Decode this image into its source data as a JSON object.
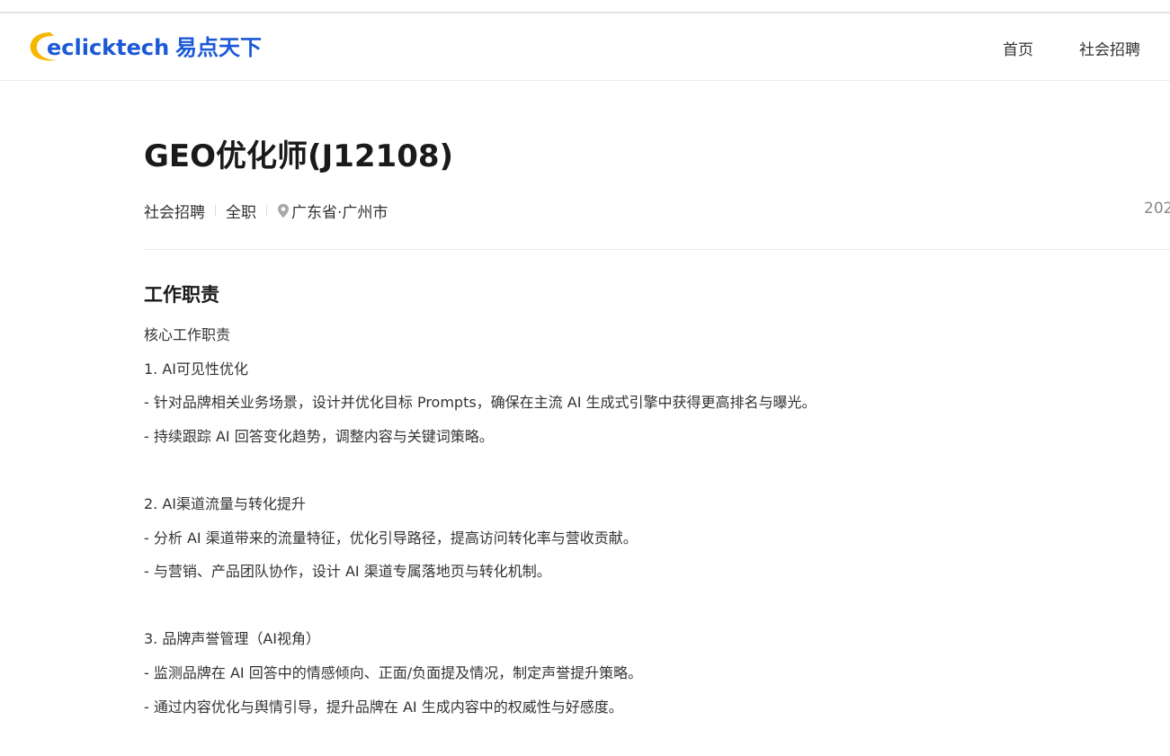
{
  "header": {
    "logo": {
      "brand_en": "eclicktech",
      "brand_cn": "易点天下",
      "swoosh_color": "#f5b800",
      "text_color": "#1b59d6"
    },
    "nav": {
      "home_label": "首页",
      "social_recruit_label": "社会招聘"
    }
  },
  "job": {
    "title": "GEO优化师(J12108)",
    "meta": {
      "category": "社会招聘",
      "type": "全职",
      "location_icon": "location-pin-icon",
      "location": "广东省·广州市",
      "date_partial": "202"
    },
    "section_heading": "工作职责",
    "description_lines": [
      "核心工作职责",
      "1. AI可见性优化",
      "- 针对品牌相关业务场景，设计并优化目标 Prompts，确保在主流 AI 生成式引擎中获得更高排名与曝光。",
      "- 持续跟踪 AI 回答变化趋势，调整内容与关键词策略。",
      "",
      "2. AI渠道流量与转化提升",
      "- 分析 AI 渠道带来的流量特征，优化引导路径，提高访问转化率与营收贡献。",
      "- 与营销、产品团队协作，设计 AI 渠道专属落地页与转化机制。",
      "",
      "3. 品牌声誉管理（AI视角）",
      "- 监测品牌在 AI 回答中的情感倾向、正面/负面提及情况，制定声誉提升策略。",
      "- 通过内容优化与舆情引导，提升品牌在 AI 生成内容中的权威性与好感度。"
    ]
  }
}
